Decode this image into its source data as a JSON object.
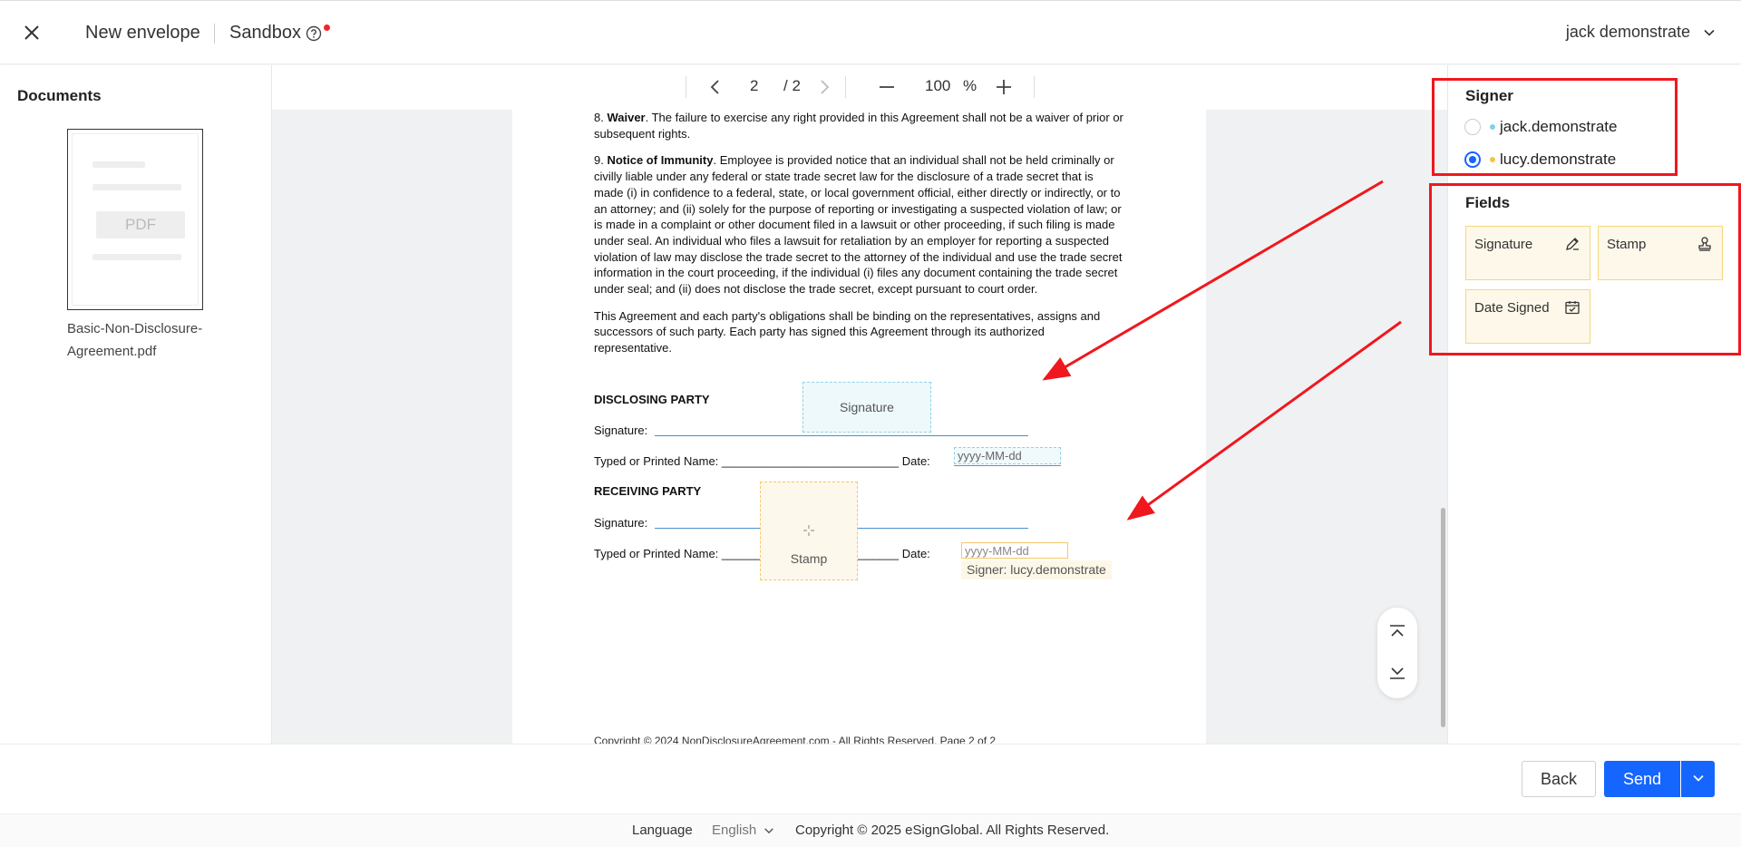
{
  "header": {
    "title": "New envelope",
    "environment": "Sandbox",
    "user_name": "jack demonstrate"
  },
  "documents": {
    "title": "Documents",
    "thumbnail_label": "PDF",
    "file_name": "Basic-Non-Disclosure-Agreement.pdf"
  },
  "toolbar": {
    "current_page": "2",
    "total_pages": "/ 2",
    "zoom": "100",
    "zoom_unit": "%"
  },
  "document_page": {
    "section8_num": "8.",
    "section8_title": "Waiver",
    "section8_text": ". The failure to exercise any right provided in this Agreement shall not be a waiver of prior or subsequent rights.",
    "section9_num": "9.",
    "section9_title": "Notice of Immunity",
    "section9_text": ". Employee is provided notice that an individual shall not be held criminally or civilly liable under any federal or state trade secret law for the disclosure of a trade secret that is made (i) in confidence to a federal, state, or local government official, either directly or indirectly, or to an attorney; and (ii) solely for the purpose of reporting or investigating a suspected violation of law; or is made in a complaint or other document filed in a lawsuit or other proceeding, if such filing is made under seal. An individual who files a lawsuit for retaliation by an employer for reporting a suspected violation of law may disclose the trade secret to the attorney of the individual and use the trade secret information in the court proceeding, if the individual (i) files any document containing the trade secret under seal; and (ii) does not disclose the trade secret, except pursuant to court order.",
    "binding_text": "This Agreement and each party's obligations shall be binding on the representatives, assigns and successors of such party. Each party has signed this Agreement through its authorized representative.",
    "disclosing_party": "DISCLOSING PARTY",
    "receiving_party": "RECEIVING PARTY",
    "signature_label": "Signature:",
    "typed_name_label": "Typed or Printed Name: ___________________________ Date:",
    "footer_partial": "Copyright © 2024 NonDisclosureAgreement.com - All Rights Reserved.                                  Page 2 of 2"
  },
  "placed_fields": {
    "signature": "Signature",
    "date_placeholder": "yyyy-MM-dd",
    "stamp": "Stamp",
    "signer_tooltip": "Signer: lucy.demonstrate"
  },
  "signer_panel": {
    "title": "Signer",
    "signers": [
      {
        "name": "jack.demonstrate",
        "color": "#7fd1ea",
        "selected": false
      },
      {
        "name": "lucy.demonstrate",
        "color": "#f5c542",
        "selected": true
      }
    ]
  },
  "fields_panel": {
    "title": "Fields",
    "items": [
      {
        "label": "Signature",
        "icon": "pen-icon"
      },
      {
        "label": "Stamp",
        "icon": "stamp-icon"
      },
      {
        "label": "Date Signed",
        "icon": "calendar-icon"
      }
    ]
  },
  "actions": {
    "back": "Back",
    "send": "Send"
  },
  "footer": {
    "language_label": "Language",
    "language_value": "English",
    "copyright": "Copyright © 2025 eSignGlobal. All Rights Reserved."
  },
  "colors": {
    "primary": "#1565ff",
    "annotation_red": "#f0171d",
    "signer_jack": "#7fd1ea",
    "signer_lucy": "#f5c542"
  }
}
